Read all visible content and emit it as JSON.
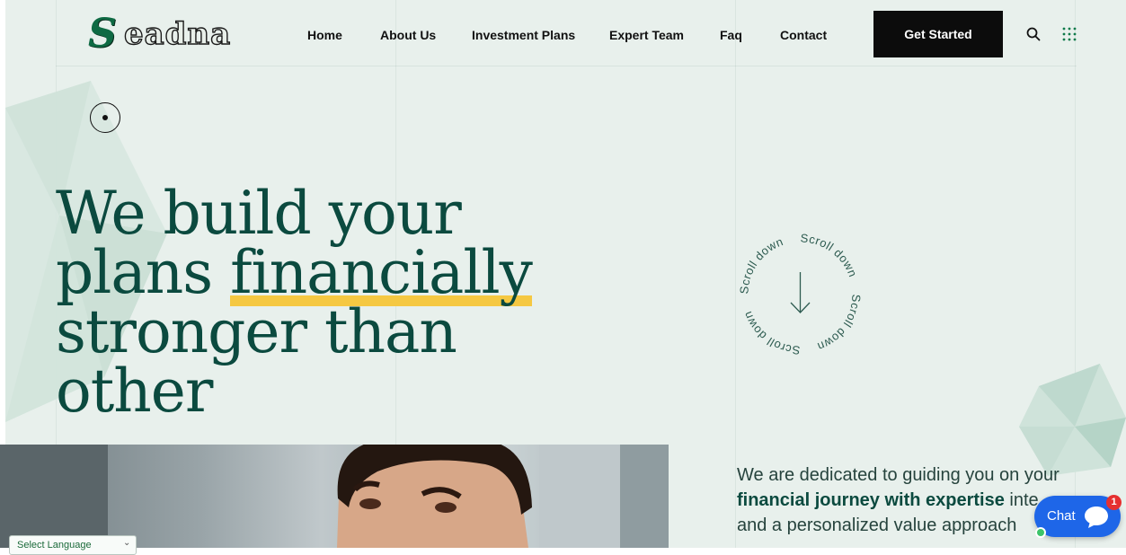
{
  "brand": {
    "logo_initial": "S",
    "logo_rest": "eadna",
    "color_green": "#0b4a3f",
    "highlight": "#f5c842"
  },
  "nav": {
    "items": [
      {
        "label": "Home"
      },
      {
        "label": "About Us"
      },
      {
        "label": "Investment Plans"
      },
      {
        "label": "Expert Team"
      },
      {
        "label": "Faq"
      },
      {
        "label": "Contact"
      }
    ],
    "cta_label": "Get Started",
    "icons": [
      "search-icon",
      "grid-menu-icon"
    ]
  },
  "hero": {
    "headline_lines": [
      "We build your",
      "plans",
      "financially",
      "stronger than",
      "other"
    ],
    "scroll_text": "Scroll down",
    "tagline_pre": "We are dedicated to guiding you on your",
    "tagline_bold": "financial journey with expertise",
    "tagline_mid": " inte",
    "tagline_line3": "and a personalized value approach"
  },
  "chat": {
    "label": "Chat",
    "badge": "1",
    "accent": "#1e66e8"
  },
  "language": {
    "label": "Select Language"
  }
}
